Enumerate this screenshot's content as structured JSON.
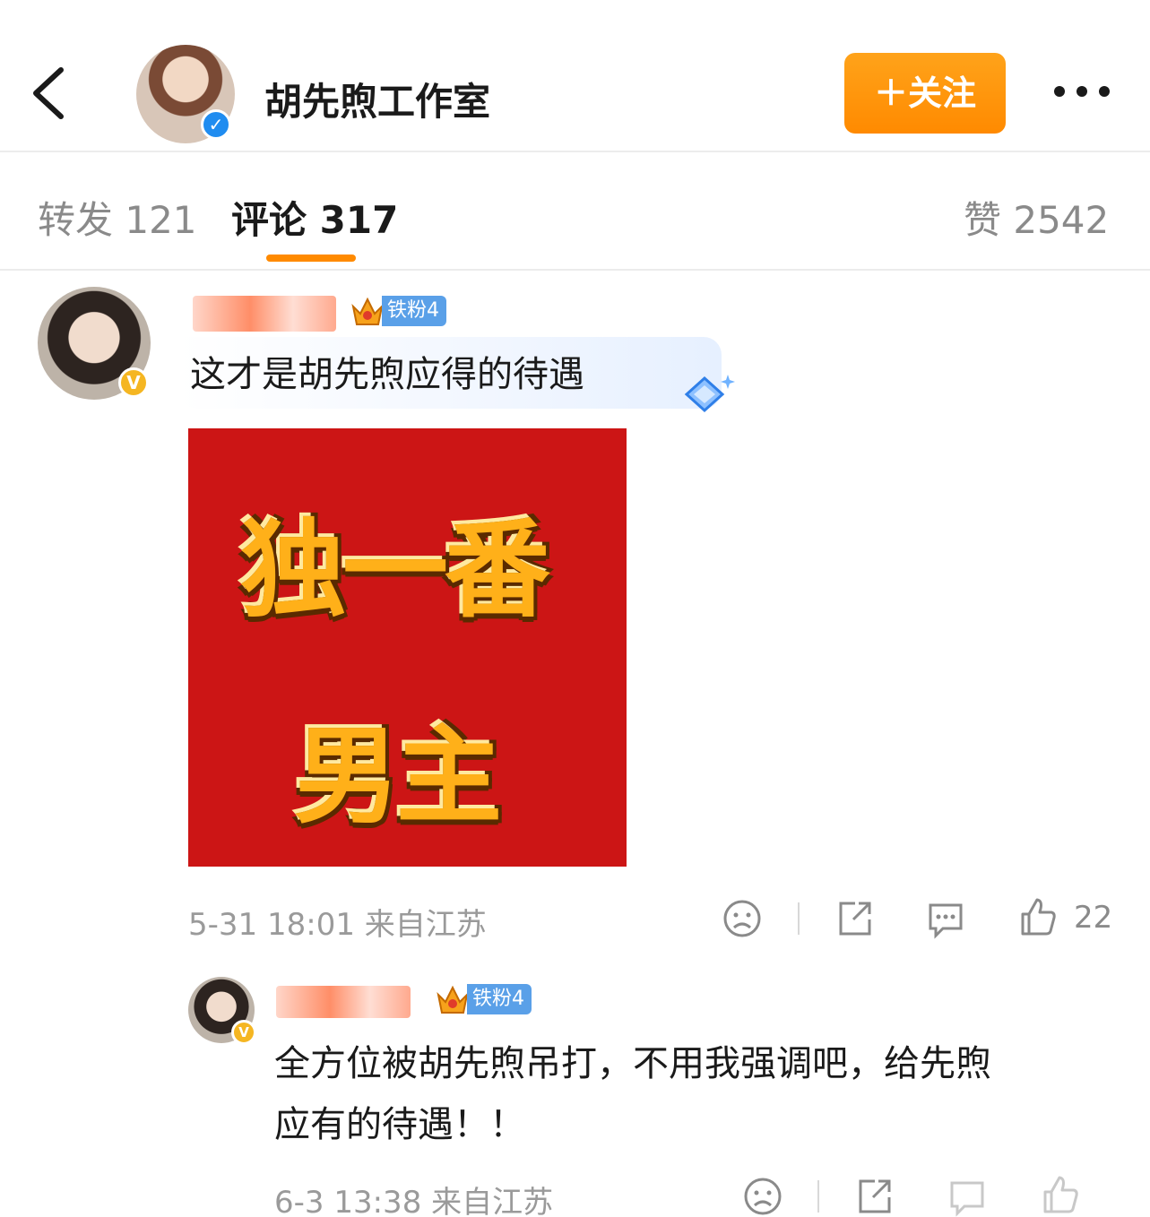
{
  "header": {
    "title": "胡先煦工作室",
    "follow_label": "＋关注"
  },
  "tabs": {
    "repost": "转发 121",
    "comment": "评论 317",
    "like": "赞 2542"
  },
  "comment1": {
    "fan_badge": "铁粉4",
    "text": "这才是胡先煦应得的待遇",
    "sticker_line1": "独一番",
    "sticker_line2": "男主",
    "time_location": "5-31 18:01 来自江苏",
    "like_count": "22"
  },
  "reply1": {
    "fan_badge": "铁粉4",
    "text_line1": "全方位被胡先煦吊打，不用我强调吧，给先煦",
    "text_line2": "应有的待遇！！",
    "time_location": "6-3 13:38 来自江苏"
  },
  "colors": {
    "accent": "#ff8a00",
    "verified_blue": "#1f8cf0",
    "verified_gold": "#f5b622",
    "fan_badge": "#5aa0e8",
    "sticker_bg": "#cc1515"
  }
}
